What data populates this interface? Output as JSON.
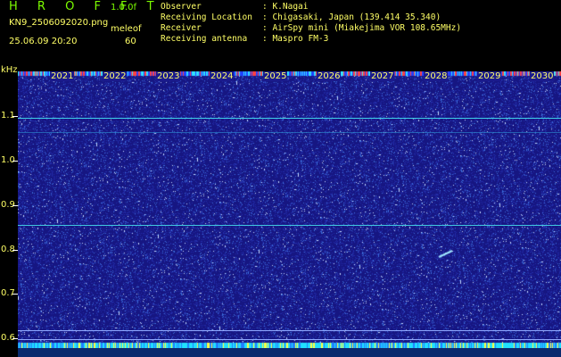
{
  "app": {
    "name": "H R O F F T",
    "version": "1.0.0f"
  },
  "file_name": "KN9_2506092020.png",
  "meteor_label": "meleof",
  "timestamp": "25.06.09 20:20",
  "count": "60",
  "info": {
    "observer_label": "Observer",
    "observer_value": ": K.Nagai",
    "location_label": "Receiving Location",
    "location_value": ": Chigasaki, Japan (139.414 35.340)",
    "receiver_label": "Receiver",
    "receiver_value": ": AirSpy mini (Miakejima VOR 108.65MHz)",
    "antenna_label": "Receiving antenna",
    "antenna_value": ": Maspro FM-3"
  },
  "axis": {
    "y_unit": "kHz",
    "y_ticks": [
      "1.1",
      "1.0",
      "0.9",
      "0.8",
      "0.7",
      "0.6"
    ],
    "x_ticks": [
      "2021",
      "2022",
      "2023",
      "2024",
      "2025",
      "2026",
      "2027",
      "2028",
      "2029",
      "2030"
    ]
  },
  "colors": {
    "background": "#1a1a8c",
    "text": "#ffff66",
    "title": "#7CFC00",
    "line": "#40c8e0"
  }
}
